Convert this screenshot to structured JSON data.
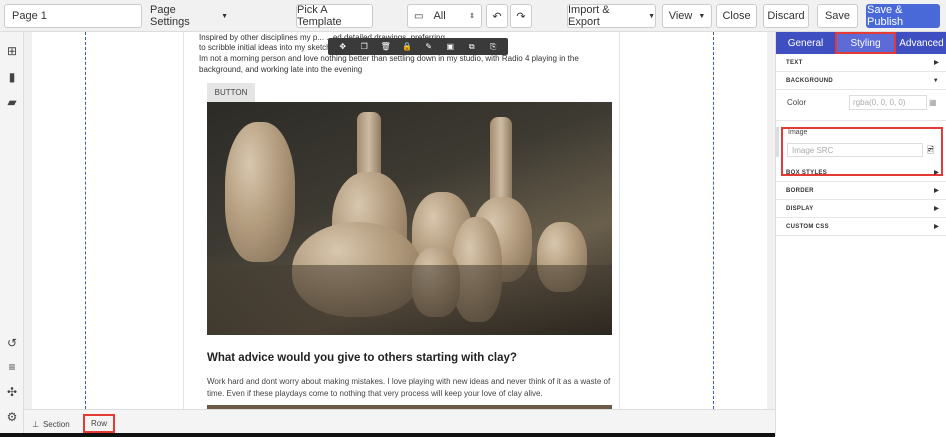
{
  "toolbar": {
    "page_name": "Page 1",
    "page_settings": "Page Settings",
    "pick_template": "Pick A Template",
    "device": "All",
    "import_export": "Import & Export",
    "view": "View",
    "close": "Close",
    "discard": "Discard",
    "save": "Save",
    "save_publish": "Save & Publish"
  },
  "canvas": {
    "text_line1": "Inspired by other disciplines my p... ...ed detailed drawings, preferring",
    "text_line2": "to scribble initial ideas into my sketch...",
    "text_line3": "Im not a morning person and love nothing better than settling down in my studio, with Radio 4 playing in the",
    "text_line4": "background, and working late into the evening",
    "button_label": "BUTTON",
    "heading": "What advice would you give to others starting with clay?",
    "paragraph": "Work hard and dont worry about making mistakes. I love playing with new ideas and never think of it as a waste of time. Even if these playdays come to nothing that very process will keep your love of clay alive."
  },
  "breadcrumb": {
    "section": "Section",
    "row": "Row"
  },
  "panel": {
    "tabs": [
      {
        "label": "General"
      },
      {
        "label": "Styling"
      },
      {
        "label": "Advanced"
      }
    ],
    "sections": {
      "text": "TEXT",
      "background": "BACKGROUND",
      "box_styles": "BOX STYLES",
      "border": "BORDER",
      "display": "DISPLAY",
      "custom_css": "CUSTOM CSS"
    },
    "color_label": "Color",
    "color_placeholder": "rgba(0, 0, 0, 0)",
    "image_label": "Image",
    "image_placeholder": "Image SRC"
  },
  "colors": {
    "accent": "#3f4fc1",
    "primary_button": "#4a69d8",
    "highlight": "#e53935"
  }
}
